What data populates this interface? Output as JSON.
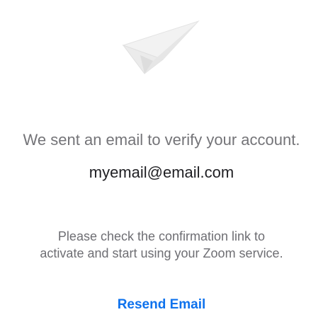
{
  "icon": "paper-plane-icon",
  "headline": "We sent an email to verify your account.",
  "email": "myemail@email.com",
  "instructions": {
    "line1": "Please check the confirmation link to",
    "line2": "activate and start using your Zoom service."
  },
  "resend_label": "Resend Email",
  "colors": {
    "accent": "#0e72ed",
    "muted_text": "#747478",
    "primary_text": "#1f1f23"
  }
}
